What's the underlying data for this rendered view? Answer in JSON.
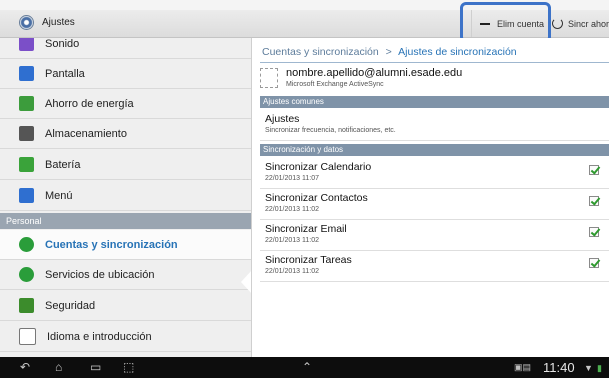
{
  "action_bar": {
    "app_icon": "settings-gear-icon",
    "title": "Ajustes",
    "elim_label": "Elim cuenta",
    "sync_label": "Sincr ahora"
  },
  "sidebar": {
    "items_top": [
      {
        "label": "Sonido",
        "icon": "sound-icon",
        "color": "#7b4fc8"
      },
      {
        "label": "Pantalla",
        "icon": "display-icon",
        "color": "#2f6fd0"
      },
      {
        "label": "Ahorro de energía",
        "icon": "power-saving-icon",
        "color": "#3c9c3c"
      },
      {
        "label": "Almacenamiento",
        "icon": "storage-icon",
        "color": "#555555"
      },
      {
        "label": "Batería",
        "icon": "battery-icon",
        "color": "#3aa33a"
      },
      {
        "label": "Menú",
        "icon": "menu-icon",
        "color": "#2f6fd0"
      }
    ],
    "section_label": "Personal",
    "items_bottom": [
      {
        "label": "Cuentas y sincronización",
        "icon": "sync-accounts-icon",
        "color": "#2a9d3a",
        "active": true
      },
      {
        "label": "Servicios de ubicación",
        "icon": "location-icon",
        "color": "#2a9d3a"
      },
      {
        "label": "Seguridad",
        "icon": "security-icon",
        "color": "#3c8c2c"
      },
      {
        "label": "Idioma e introducción",
        "icon": "language-icon",
        "color": "#777777"
      }
    ]
  },
  "detail": {
    "breadcrumb_parent": "Cuentas y sincronización",
    "breadcrumb_sep": ">",
    "breadcrumb_current": "Ajustes de sincronización",
    "account_email": "nombre.apellido@alumni.esade.edu",
    "account_type": "Microsoft Exchange ActiveSync",
    "section_common": "Ajustes comunes",
    "settings_title": "Ajustes",
    "settings_sub": "Sincronizar frecuencia, notificaciones, etc.",
    "section_sync": "Sincronización y datos",
    "sync_rows": [
      {
        "title": "Sincronizar Calendario",
        "date": "22/01/2013 11:07",
        "checked": true
      },
      {
        "title": "Sincronizar Contactos",
        "date": "22/01/2013 11:02",
        "checked": true
      },
      {
        "title": "Sincronizar Email",
        "date": "22/01/2013 11:02",
        "checked": true
      },
      {
        "title": "Sincronizar Tareas",
        "date": "22/01/2013 11:02",
        "checked": true
      }
    ]
  },
  "navbar": {
    "clock": "11:40",
    "icons": [
      "back-icon",
      "home-icon",
      "recent-apps-icon",
      "screenshot-icon",
      "up-arrow-icon",
      "notification-icons",
      "wifi-icon",
      "battery-icon"
    ]
  },
  "colors": {
    "accent": "#2773b6",
    "highlight": "#3d73c8",
    "check": "#2f9a2f"
  }
}
